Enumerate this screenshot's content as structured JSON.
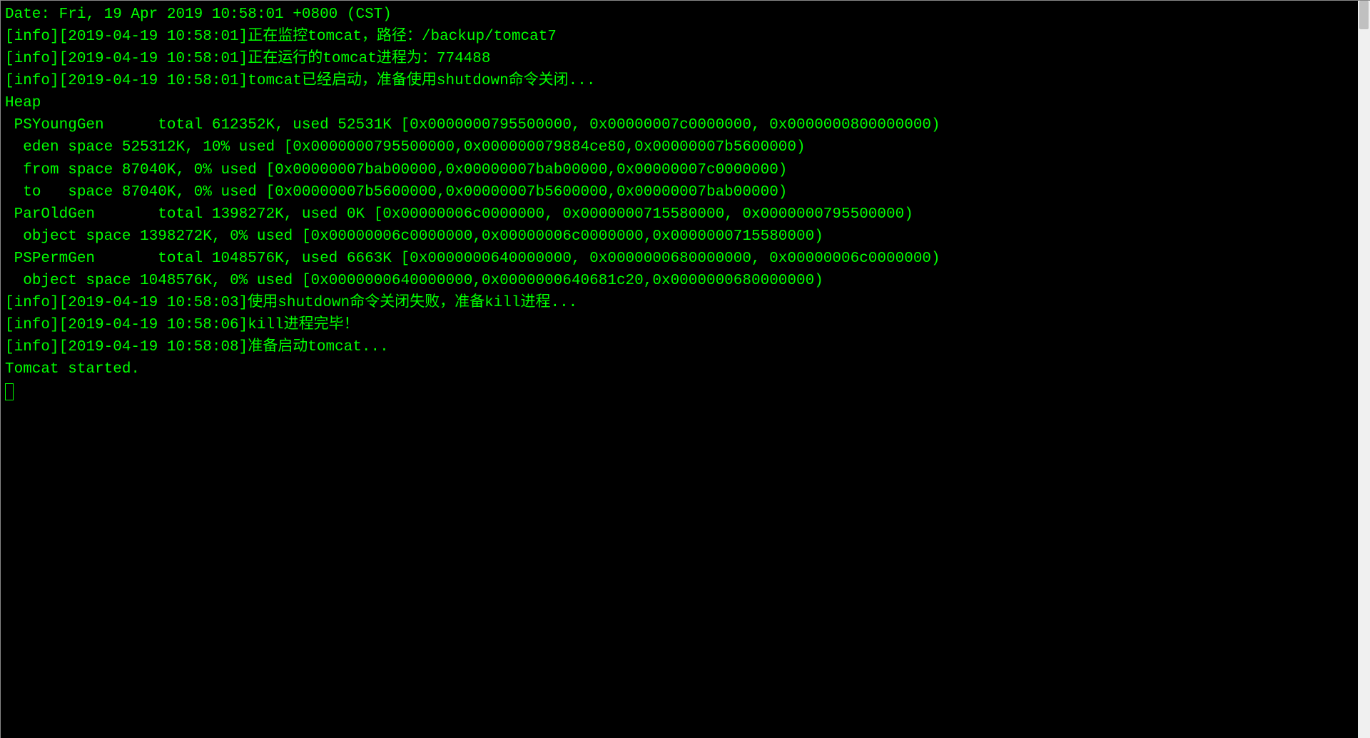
{
  "terminal": {
    "colors": {
      "fg": "#00ff00",
      "bg": "#000000"
    },
    "lines": [
      "Date: Fri, 19 Apr 2019 10:58:01 +0800 (CST)",
      "",
      "[info][2019-04-19 10:58:01]正在监控tomcat，路径：/backup/tomcat7",
      "[info][2019-04-19 10:58:01]正在运行的tomcat进程为：774488",
      "[info][2019-04-19 10:58:01]tomcat已经启动，准备使用shutdown命令关闭...",
      "Heap",
      " PSYoungGen      total 612352K, used 52531K [0x0000000795500000, 0x00000007c0000000, 0x0000000800000000)",
      "  eden space 525312K, 10% used [0x0000000795500000,0x000000079884ce80,0x00000007b5600000)",
      "  from space 87040K, 0% used [0x00000007bab00000,0x00000007bab00000,0x00000007c0000000)",
      "  to   space 87040K, 0% used [0x00000007b5600000,0x00000007b5600000,0x00000007bab00000)",
      " ParOldGen       total 1398272K, used 0K [0x00000006c0000000, 0x0000000715580000, 0x0000000795500000)",
      "  object space 1398272K, 0% used [0x00000006c0000000,0x00000006c0000000,0x0000000715580000)",
      " PSPermGen       total 1048576K, used 6663K [0x0000000640000000, 0x0000000680000000, 0x00000006c0000000)",
      "  object space 1048576K, 0% used [0x0000000640000000,0x0000000640681c20,0x0000000680000000)",
      "[info][2019-04-19 10:58:03]使用shutdown命令关闭失败，准备kill进程...",
      "[info][2019-04-19 10:58:06]kill进程完毕！",
      "[info][2019-04-19 10:58:08]准备启动tomcat...",
      "Tomcat started.",
      ""
    ]
  }
}
